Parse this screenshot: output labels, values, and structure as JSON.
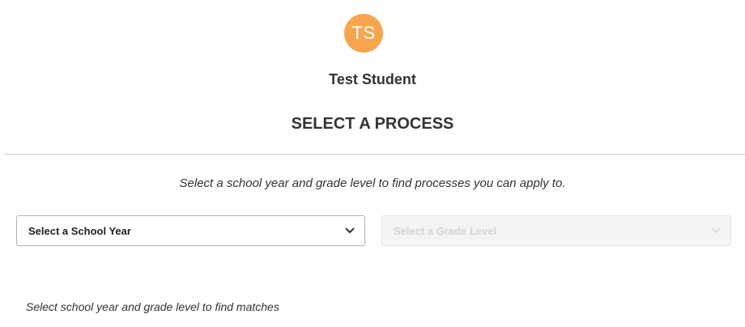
{
  "student": {
    "initials": "TS",
    "avatar_color": "#F7A64E",
    "name": "Test Student"
  },
  "page_title": "SELECT A PROCESS",
  "instruction": "Select a school year and grade level to find processes you can apply to.",
  "filters": {
    "school_year": {
      "selected": "Select a School Year",
      "disabled": false,
      "icon": "chevron-down-icon"
    },
    "grade_level": {
      "selected": "Select a Grade Level",
      "disabled": true,
      "icon": "chevron-down-icon"
    }
  },
  "results": {
    "empty_message": "Select school year and grade level to find matches"
  }
}
